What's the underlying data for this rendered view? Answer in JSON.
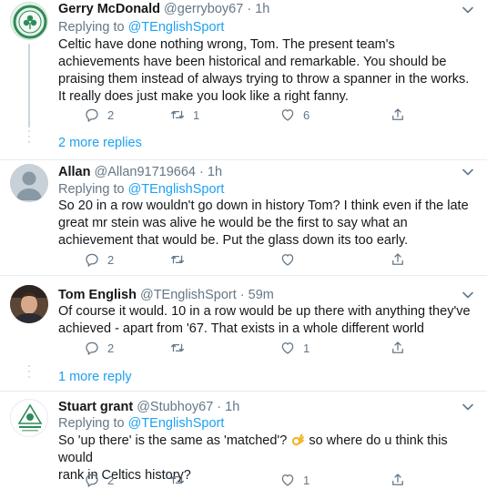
{
  "replies": [
    {
      "name": "Gerry McDonald",
      "handle": "@gerryboy67",
      "sep": "·",
      "time": "1h",
      "replying_prefix": "Replying to ",
      "replying_to": "@TEnglishSport",
      "text": "Celtic have done nothing wrong, Tom. The present team's achievements have been historical and remarkable. You should be praising them instead of always trying to throw a spanner in the works. It really does just make you look like a right fanny.",
      "reply_count": "2",
      "retweet_count": "1",
      "like_count": "6"
    },
    {
      "name": "Allan",
      "handle": "@Allan91719664",
      "sep": "·",
      "time": "1h",
      "replying_prefix": "Replying to ",
      "replying_to": "@TEnglishSport",
      "text": "So 20 in a row wouldn't go down in history Tom? I think even if the late great mr stein was alive he would be the first to say what an achievement that would be. Put the glass down its too early.",
      "reply_count": "2",
      "retweet_count": "",
      "like_count": ""
    },
    {
      "name": "Tom English",
      "handle": "@TEnglishSport",
      "sep": "·",
      "time": "59m",
      "text": "Of course it would. 10 in a row would be up there with anything they've achieved - apart from '67. That exists in a whole different world",
      "reply_count": "2",
      "retweet_count": "",
      "like_count": "1"
    },
    {
      "name": "Stuart grant",
      "handle": "@Stubhoy67",
      "sep": "·",
      "time": "1h",
      "replying_prefix": "Replying to ",
      "replying_to": "@TEnglishSport",
      "text_line1": "So 'up there' is the same as 'matched'?",
      "text_line1_after": " so where do u think this would",
      "text_line2": "rank in Celtics history?",
      "reply_count": "2",
      "retweet_count": "",
      "like_count": "1"
    }
  ],
  "more_replies": [
    "2 more replies",
    "1 more reply"
  ],
  "colors": {
    "accent": "#1da1f2",
    "muted": "#657786",
    "text": "#14171a",
    "divider": "#e6ecf0"
  },
  "icons": [
    "reply-icon",
    "retweet-icon",
    "like-icon",
    "share-icon",
    "chevron-down-icon",
    "ok-hand-emoji"
  ]
}
